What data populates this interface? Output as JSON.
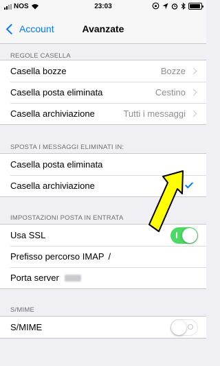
{
  "status_bar": {
    "carrier": "NOS",
    "time": "23:03",
    "icons": [
      "signal-icon",
      "wifi-icon",
      "screen-lock-icon",
      "location-icon",
      "alarm-icon",
      "bluetooth-icon",
      "battery-icon"
    ]
  },
  "nav": {
    "back_label": "Account",
    "title": "Avanzate"
  },
  "sections": {
    "regole": {
      "header": "REGOLE CASELLA",
      "rows": [
        {
          "label": "Casella bozze",
          "value": "Bozze"
        },
        {
          "label": "Casella posta eliminata",
          "value": "Cestino"
        },
        {
          "label": "Casella archiviazione",
          "value": "Tutti i messaggi"
        }
      ]
    },
    "sposta": {
      "header": "SPOSTA I MESSAGGI ELIMINATI IN:",
      "rows": [
        {
          "label": "Casella posta eliminata",
          "selected": false
        },
        {
          "label": "Casella archiviazione",
          "selected": true
        }
      ]
    },
    "impostazioni": {
      "header": "IMPOSTAZIONI POSTA IN ENTRATA",
      "use_ssl_label": "Usa SSL",
      "use_ssl_on": true,
      "imap_prefix_label": "Prefisso percorso IMAP",
      "imap_prefix_value": "/",
      "server_port_label": "Porta server"
    },
    "smime": {
      "header": "S/MIME",
      "label": "S/MIME",
      "on": false
    }
  },
  "colors": {
    "accent": "#007aff",
    "toggle_on": "#4cd964",
    "annotation_arrow": "#ffff00",
    "background": "#efeff4"
  }
}
